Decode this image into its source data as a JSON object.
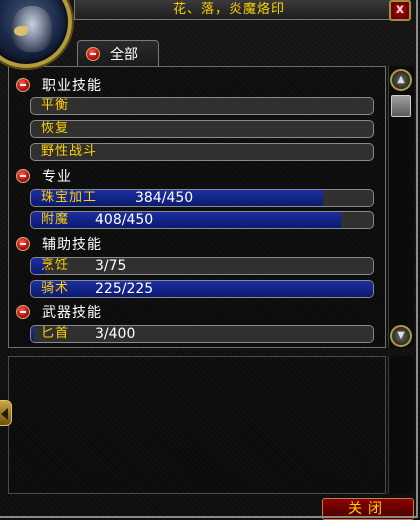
{
  "window": {
    "title": "花、落，炎魔烙印",
    "close_glyph": "x"
  },
  "tab": {
    "label": "全部"
  },
  "categories": [
    {
      "label": "职业技能",
      "skills": [
        {
          "name": "平衡",
          "value": ""
        },
        {
          "name": "恢复",
          "value": ""
        },
        {
          "name": "野性战斗",
          "value": ""
        }
      ]
    },
    {
      "label": "专业",
      "skills": [
        {
          "name": "珠宝加工",
          "value": "384/450",
          "progress": 0.853
        },
        {
          "name": "附魔",
          "value": "408/450",
          "progress": 0.907
        }
      ]
    },
    {
      "label": "辅助技能",
      "skills": [
        {
          "name": "烹饪",
          "value": "3/75",
          "progress": 0.04
        },
        {
          "name": "骑术",
          "value": "225/225",
          "progress": 1.0
        }
      ]
    },
    {
      "label": "武器技能",
      "skills": [
        {
          "name": "匕首",
          "value": "3/400",
          "progress": 0.0075
        }
      ]
    }
  ],
  "footer": {
    "close_label": "关闭"
  },
  "colors": {
    "skill_name": "#ffd200",
    "bar_fill": "#1c2fa0",
    "bar_bg": "#303030",
    "accent_red": "#c01010"
  },
  "icons": {
    "portrait": "owlkin-portrait",
    "collapse": "minus-icon",
    "scroll_up": "scroll-up-arrow-icon",
    "scroll_down": "scroll-down-arrow-icon",
    "side_arrow": "chevron-left-icon"
  }
}
